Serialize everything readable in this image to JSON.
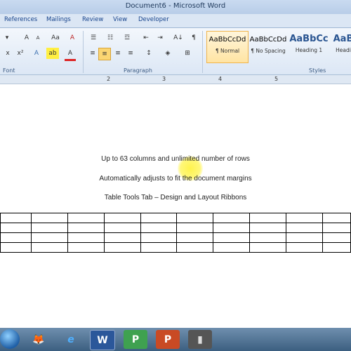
{
  "window": {
    "title": "Document6 - Microsoft Word"
  },
  "tabs": [
    "References",
    "Mailings",
    "Review",
    "View",
    "Developer"
  ],
  "ribbon": {
    "font_group_label": "Font",
    "paragraph_group_label": "Paragraph",
    "styles_group_label": "Styles",
    "styles": [
      {
        "sample": "AaBbCcDd",
        "name": "¶ Normal"
      },
      {
        "sample": "AaBbCcDd",
        "name": "¶ No Spacing"
      },
      {
        "sample": "AaBbCc",
        "name": "Heading 1"
      },
      {
        "sample": "AaB",
        "name": "Headi"
      }
    ]
  },
  "ruler": {
    "numbers": [
      "2",
      "3",
      "4",
      "5"
    ]
  },
  "document": {
    "lines": [
      "Up to 63 columns and unlimited  number of rows",
      "Automatically adjusts to fit the document margins",
      "Table Tools Tab – Design and Layout Ribbons"
    ],
    "table": {
      "rows": 4,
      "cols": 10
    }
  },
  "taskbar": {
    "apps": [
      {
        "name": "firefox-icon",
        "glyph": "🦊"
      },
      {
        "name": "internet-explorer-icon",
        "glyph": "e"
      },
      {
        "name": "word-icon",
        "glyph": "W"
      },
      {
        "name": "project-icon",
        "glyph": "P"
      },
      {
        "name": "powerpoint-icon",
        "glyph": "P"
      },
      {
        "name": "media-icon",
        "glyph": "▮"
      }
    ]
  }
}
